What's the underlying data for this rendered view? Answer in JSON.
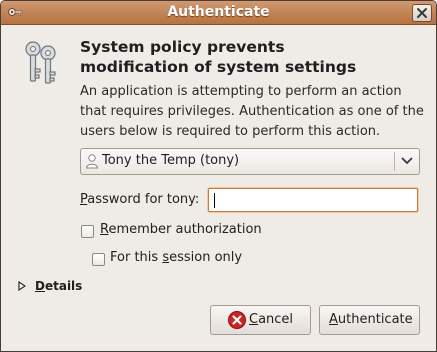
{
  "window": {
    "title": "Authenticate"
  },
  "dialog": {
    "heading_line1": "System policy prevents",
    "heading_line2": "modification of system settings",
    "description_line1": "An application is attempting to perform an action",
    "description_line2": "that requires privileges. Authentication as one of the",
    "description_line3": "users below is required to perform this action.",
    "selected_user": "Tony the Temp (tony)",
    "password_label_prefix": "P",
    "password_label_rest": "assword for tony:",
    "password_value": "",
    "remember": {
      "mnemonic": "R",
      "label_rest": "emember authorization",
      "checked": false
    },
    "session_only": {
      "label_before": "For this ",
      "mnemonic": "s",
      "label_after": "ession only",
      "checked": false
    },
    "details_mnemonic": "D",
    "details_rest": "etails",
    "cancel_mnemonic": "C",
    "cancel_rest": "ancel",
    "authenticate_mnemonic": "A",
    "authenticate_rest": "uthenticate"
  },
  "icons": {
    "titlebar_menu": "key-icon",
    "close": "close-icon",
    "dialog": "keys-icon",
    "user": "person-icon",
    "dropdown": "chevron-down-icon",
    "details": "expander-arrow-icon",
    "cancel": "cancel-icon"
  },
  "colors": {
    "titlebar": "#c48659",
    "focus_border": "#d07a3a",
    "window_bg": "#efebe7",
    "cancel_red": "#cc2222"
  }
}
